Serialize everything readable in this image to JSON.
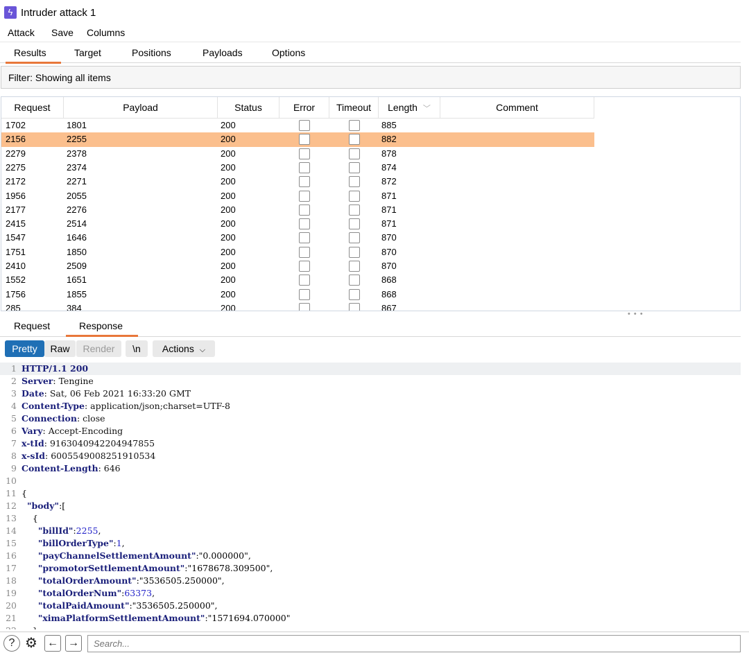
{
  "window": {
    "title": "Intruder attack 1"
  },
  "menu": [
    "Attack",
    "Save",
    "Columns"
  ],
  "tabs": [
    "Results",
    "Target",
    "Positions",
    "Payloads",
    "Options"
  ],
  "filter": {
    "text": "Filter: Showing all items"
  },
  "table": {
    "columns": [
      "Request",
      "Payload",
      "Status",
      "Error",
      "Timeout",
      "Length",
      "Comment"
    ],
    "sort_icon": "chevron-down-icon",
    "selected_row": 1,
    "rows": [
      {
        "request": "1702",
        "payload": "1801",
        "status": "200",
        "length": "885"
      },
      {
        "request": "2156",
        "payload": "2255",
        "status": "200",
        "length": "882"
      },
      {
        "request": "2279",
        "payload": "2378",
        "status": "200",
        "length": "878"
      },
      {
        "request": "2275",
        "payload": "2374",
        "status": "200",
        "length": "874"
      },
      {
        "request": "2172",
        "payload": "2271",
        "status": "200",
        "length": "872"
      },
      {
        "request": "1956",
        "payload": "2055",
        "status": "200",
        "length": "871"
      },
      {
        "request": "2177",
        "payload": "2276",
        "status": "200",
        "length": "871"
      },
      {
        "request": "2415",
        "payload": "2514",
        "status": "200",
        "length": "871"
      },
      {
        "request": "1547",
        "payload": "1646",
        "status": "200",
        "length": "870"
      },
      {
        "request": "1751",
        "payload": "1850",
        "status": "200",
        "length": "870"
      },
      {
        "request": "2410",
        "payload": "2509",
        "status": "200",
        "length": "870"
      },
      {
        "request": "1552",
        "payload": "1651",
        "status": "200",
        "length": "868"
      },
      {
        "request": "1756",
        "payload": "1855",
        "status": "200",
        "length": "868"
      },
      {
        "request": "285",
        "payload": "384",
        "status": "200",
        "length": "867"
      }
    ]
  },
  "subtabs": [
    "Request",
    "Response"
  ],
  "view_buttons": {
    "pretty": "Pretty",
    "raw": "Raw",
    "render": "Render",
    "newline": "\\n",
    "actions": "Actions"
  },
  "response_lines": [
    "HTTP/1.1 200",
    "Server: Tengine",
    "Date: Sat, 06 Feb 2021 16:33:20 GMT",
    "Content-Type: application/json;charset=UTF-8",
    "Connection: close",
    "Vary: Accept-Encoding",
    "x-tId: 9163040942204947855",
    "x-sId: 6005549008251910534",
    "Content-Length: 646",
    "",
    "{",
    "  \"body\":[",
    "    {",
    "      \"billId\":2255,",
    "      \"billOrderType\":1,",
    "      \"payChannelSettlementAmount\":\"0.000000\",",
    "      \"promotorSettlementAmount\":\"1678678.309500\",",
    "      \"totalOrderAmount\":\"3536505.250000\",",
    "      \"totalOrderNum\":63373,",
    "      \"totalPaidAmount\":\"3536505.250000\",",
    "      \"ximaPlatformSettlementAmount\":\"1571694.070000\"",
    "    },"
  ],
  "footer": {
    "icons": [
      "help-icon",
      "settings-icon",
      "back-arrow-icon",
      "forward-arrow-icon"
    ],
    "search_placeholder": "Search..."
  },
  "colors": {
    "accent": "#e8773a",
    "selected_row": "#fbbf8d",
    "pretty_active": "#1f6fb5"
  }
}
